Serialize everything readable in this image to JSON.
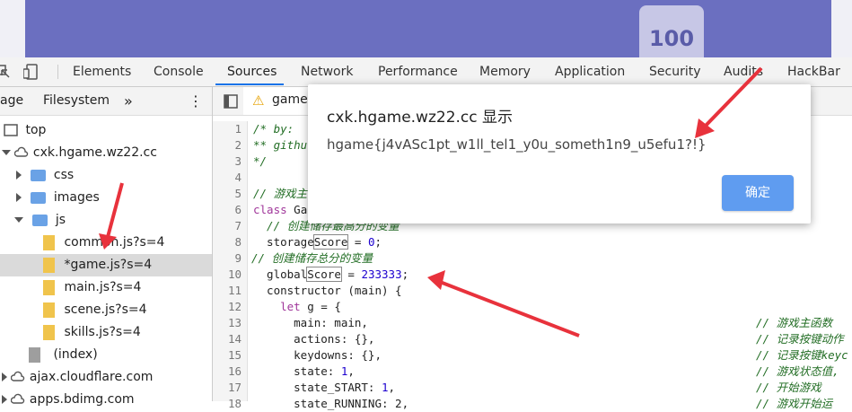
{
  "banner": {
    "logo_text": "100"
  },
  "devtools_tabs": [
    "Elements",
    "Console",
    "Sources",
    "Network",
    "Performance",
    "Memory",
    "Application",
    "Security",
    "Audits",
    "HackBar"
  ],
  "active_tab": "Sources",
  "navigator": {
    "tabs": [
      "age",
      "Filesystem"
    ],
    "more": "»",
    "menu": "⋮",
    "tree": [
      {
        "label": "top",
        "kind": "frame"
      },
      {
        "label": "cxk.hgame.wz22.cc",
        "kind": "domain"
      },
      {
        "label": "css",
        "kind": "folder"
      },
      {
        "label": "images",
        "kind": "folder"
      },
      {
        "label": "js",
        "kind": "folder"
      },
      {
        "label": "common.js?s=4",
        "kind": "file"
      },
      {
        "label": "*game.js?s=4",
        "kind": "file"
      },
      {
        "label": "main.js?s=4",
        "kind": "file"
      },
      {
        "label": "scene.js?s=4",
        "kind": "file"
      },
      {
        "label": "skills.js?s=4",
        "kind": "file"
      },
      {
        "label": "(index)",
        "kind": "file"
      },
      {
        "label": "ajax.cloudflare.com",
        "kind": "domain"
      },
      {
        "label": "apps.bdimg.com",
        "kind": "domain"
      }
    ]
  },
  "editor": {
    "tab_label": "game.",
    "warning_icon": "⚠",
    "line_numbers": [
      "1",
      "2",
      "3",
      "4",
      "5",
      "6",
      "7",
      "8",
      "9",
      "10",
      "11",
      "12",
      "13",
      "14",
      "15",
      "16",
      "17",
      "18"
    ],
    "lines": {
      "l1": "/* by: ",
      "l2": "** githu",
      "l3": "*/",
      "l5": "// 游戏主",
      "l6_kw": "class",
      "l6_name": " Ga",
      "l7": "  // 创建储存最高分的变量",
      "l8_a": "  storage",
      "l8_b": "Score",
      "l8_c": " = ",
      "l8_d": "0",
      "l8_e": ";",
      "l9": "// 创建储存总分的变量",
      "l10_a": "  global",
      "l10_b": "Score",
      "l10_c": " = ",
      "l10_d": "233333",
      "l10_e": ";",
      "l11": "  constructor (main) {",
      "l12_kw": "    let",
      "l12_rest": " g = {",
      "l13": "      main: main,",
      "l13_c": "// 游戏主函数",
      "l14": "      actions: {},",
      "l14_c": "// 记录按键动作",
      "l15": "      keydowns: {},",
      "l15_c": "// 记录按键keyc",
      "l16_a": "      state: ",
      "l16_b": "1",
      "l16_c": ",",
      "l16_cmt": "// 游戏状态值,",
      "l17_a": "      state_START: ",
      "l17_b": "1",
      "l17_c": ",",
      "l17_cmt": "// 开始游戏",
      "l18": "      state_RUNNING: 2,",
      "l18_c": "// 游戏开始运"
    }
  },
  "dialog": {
    "title": "cxk.hgame.wz22.cc 显示",
    "message": "hgame{j4vASc1pt_w1ll_tel1_y0u_someth1n9_u5efu1?!}",
    "ok_label": "确定"
  },
  "colors": {
    "annotation_arrow": "#e8323c",
    "accent": "#1a73e8",
    "button": "#5f9cf0"
  }
}
